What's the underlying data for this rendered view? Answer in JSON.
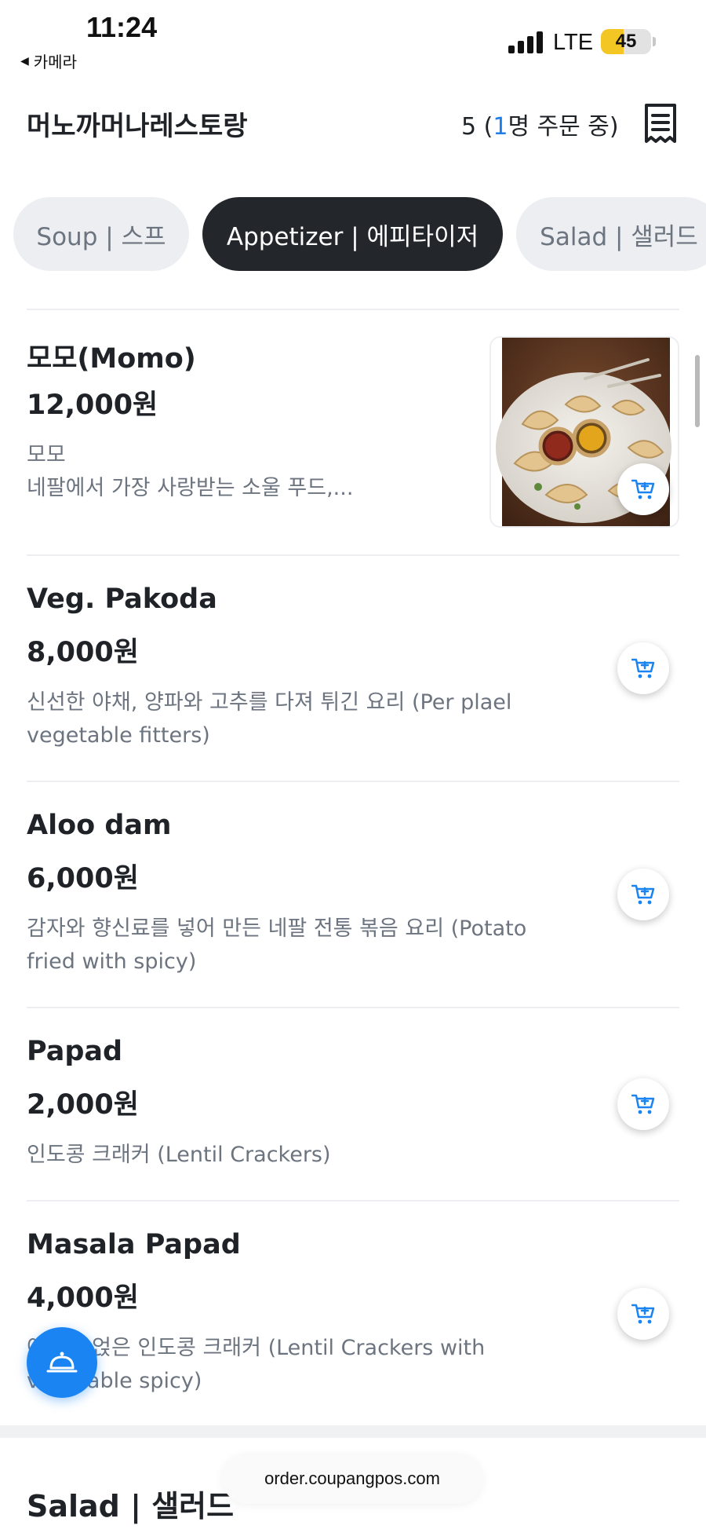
{
  "status_bar": {
    "time": "11:24",
    "back_app": "카메라",
    "network": "LTE",
    "battery": "45",
    "battery_level": 0.45
  },
  "header": {
    "restaurant_name": "머노까머나레스토랑",
    "order_count": "5",
    "order_paren_open": " (",
    "order_people": "1",
    "order_suffix": "명 주문 중)",
    "receipt_icon": "receipt-icon"
  },
  "categories": [
    {
      "label": "Soup | 스프",
      "active": false
    },
    {
      "label": "Appetizer | 에피타이저",
      "active": true
    },
    {
      "label": "Salad | 샐러드",
      "active": false
    }
  ],
  "menu_items": [
    {
      "name": "모모(Momo)",
      "price": "12,000원",
      "desc_lines": [
        "모모",
        "네팔에서 가장 사랑받는 소울 푸드,..."
      ],
      "has_image": true
    },
    {
      "name": "Veg. Pakoda",
      "price": "8,000원",
      "desc_lines": [
        "신선한 야채, 양파와 고추를 다져 튀긴 요리 (Per plael",
        "vegetable fitters)"
      ],
      "has_image": false
    },
    {
      "name": "Aloo dam",
      "price": "6,000원",
      "desc_lines": [
        "감자와 향신료를 넣어 만든 네팔 전통 볶음 요리 (Potato",
        "fried with spicy)"
      ],
      "has_image": false
    },
    {
      "name": "Papad",
      "price": "2,000원",
      "desc_lines": [
        "인도콩 크래커 (Lentil Crackers)"
      ],
      "has_image": false
    },
    {
      "name": "Masala Papad",
      "price": "4,000원",
      "desc_lines": [
        "야채를 얹은 인도콩 크래커 (Lentil Crackers with",
        "vegetable spicy)"
      ],
      "has_image": false
    }
  ],
  "next_section": "Salad | 샐러드",
  "url": "order.coupangpos.com",
  "colors": {
    "accent": "#1a85f2",
    "active_chip": "#23272b",
    "chip": "#eceef1",
    "text_muted": "#6c7480"
  },
  "icons": {
    "cart": "add-to-cart-icon",
    "fab": "call-staff-bell-icon"
  }
}
